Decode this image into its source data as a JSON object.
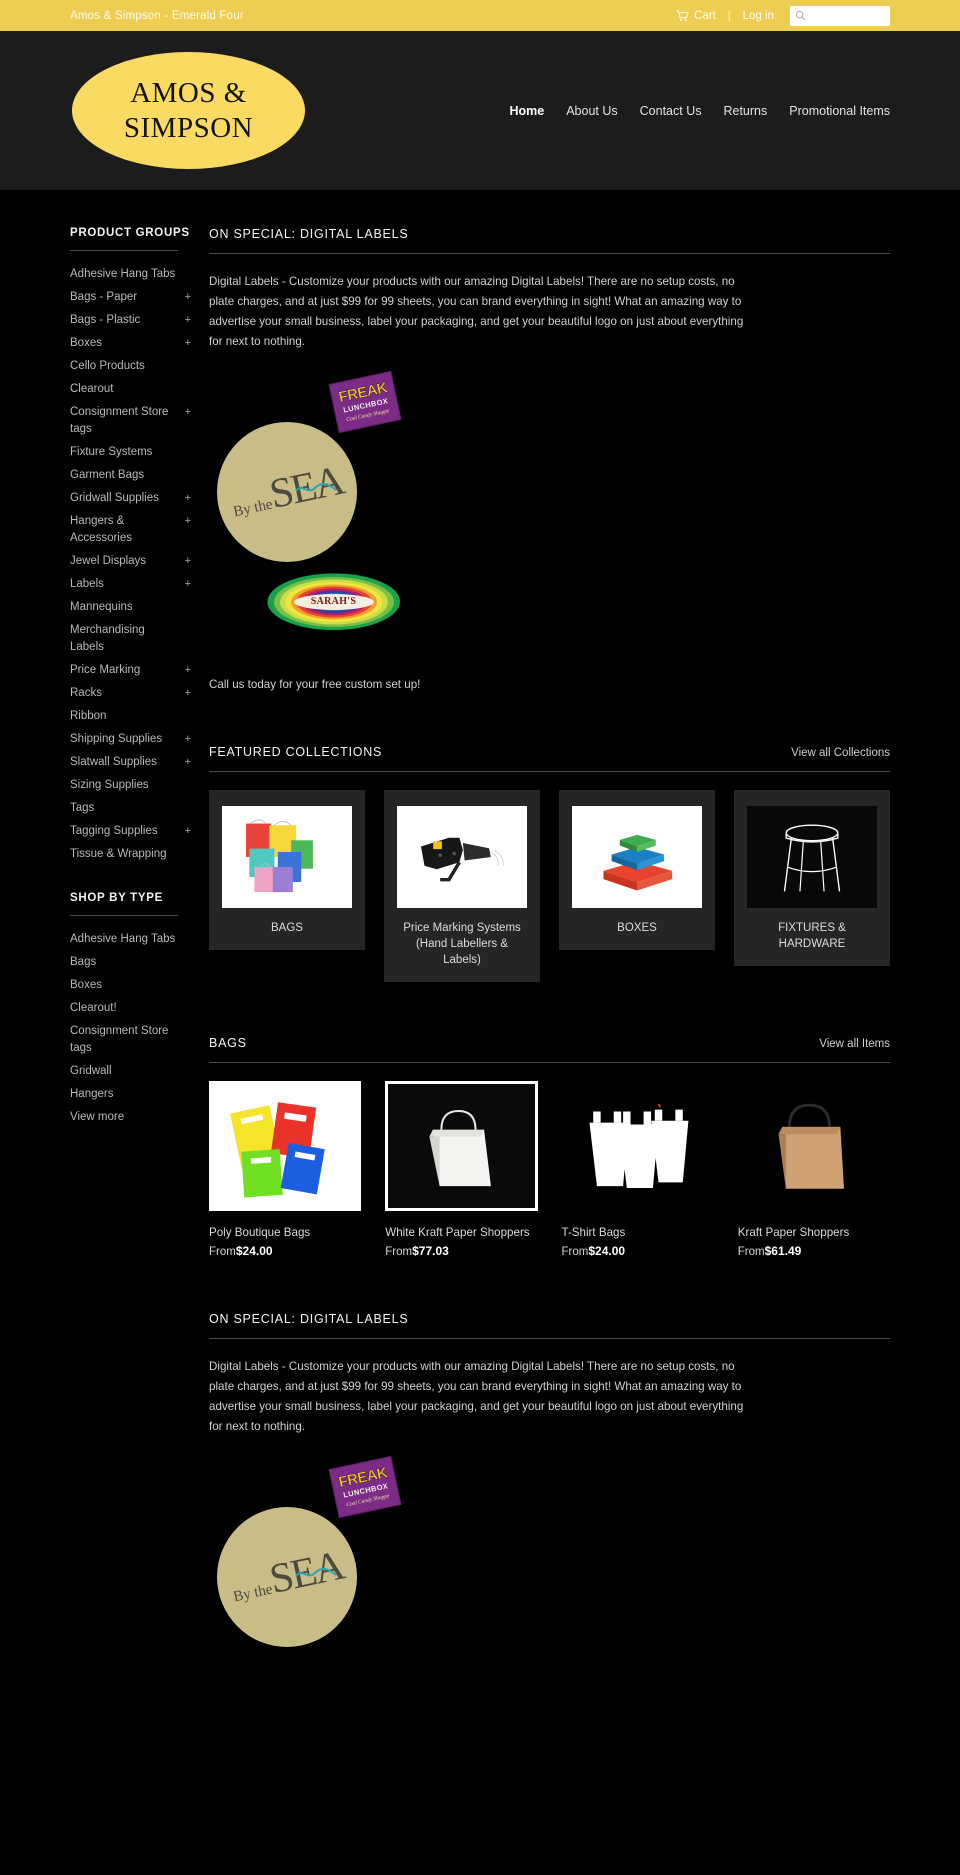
{
  "topbar": {
    "brand": "Amos & Simpson - Emerald Four",
    "cart_label": "Cart",
    "cart_icon": "shopping-cart-icon",
    "separator": "|",
    "login_label": "Log in",
    "search_placeholder": "",
    "search_value": "",
    "search_icon": "search-icon",
    "bg_color": "#edcd52"
  },
  "header": {
    "logo_line1": "AMOS &",
    "logo_line2": "SIMPSON",
    "logo_color": "#f9da63",
    "nav": [
      {
        "label": "Home",
        "active": true
      },
      {
        "label": "About Us",
        "active": false
      },
      {
        "label": "Contact Us",
        "active": false
      },
      {
        "label": "Returns",
        "active": false
      },
      {
        "label": "Promotional Items",
        "active": false
      }
    ]
  },
  "sidebar": {
    "product_groups_title": "PRODUCT GROUPS",
    "product_groups": [
      {
        "label": "Adhesive Hang Tabs",
        "expand": ""
      },
      {
        "label": "Bags - Paper",
        "expand": "+"
      },
      {
        "label": "Bags - Plastic",
        "expand": "+"
      },
      {
        "label": "Boxes",
        "expand": "+"
      },
      {
        "label": "Cello Products",
        "expand": ""
      },
      {
        "label": "Clearout",
        "expand": ""
      },
      {
        "label": "Consignment Store tags",
        "expand": "+"
      },
      {
        "label": "Fixture Systems",
        "expand": ""
      },
      {
        "label": "Garment Bags",
        "expand": ""
      },
      {
        "label": "Gridwall Supplies",
        "expand": "+"
      },
      {
        "label": "Hangers & Accessories",
        "expand": "+"
      },
      {
        "label": "Jewel Displays",
        "expand": "+"
      },
      {
        "label": "Labels",
        "expand": "+"
      },
      {
        "label": "Mannequins",
        "expand": ""
      },
      {
        "label": "Merchandising Labels",
        "expand": ""
      },
      {
        "label": "Price Marking",
        "expand": "+"
      },
      {
        "label": "Racks",
        "expand": "+"
      },
      {
        "label": "Ribbon",
        "expand": ""
      },
      {
        "label": "Shipping Supplies",
        "expand": "+"
      },
      {
        "label": "Slatwall Supplies",
        "expand": "+"
      },
      {
        "label": "Sizing Supplies",
        "expand": ""
      },
      {
        "label": "Tags",
        "expand": ""
      },
      {
        "label": "Tagging Supplies",
        "expand": "+"
      },
      {
        "label": "Tissue & Wrapping",
        "expand": ""
      }
    ],
    "shop_by_type_title": "SHOP BY TYPE",
    "shop_by_type": [
      {
        "label": "Adhesive Hang Tabs"
      },
      {
        "label": "Bags"
      },
      {
        "label": "Boxes"
      },
      {
        "label": "Clearout!"
      },
      {
        "label": "Consignment Store tags"
      },
      {
        "label": "Gridwall"
      },
      {
        "label": "Hangers"
      },
      {
        "label": "View more"
      }
    ]
  },
  "special": {
    "title": "ON SPECIAL: DIGITAL LABELS",
    "body": "Digital Labels - Customize your products with our amazing Digital Labels! There are no setup costs, no plate charges, and at just $99 for 99 sheets, you can brand everything in sight!  What an amazing way to advertise your small business, label your packaging, and get your beautiful logo on just about everything for next to nothing.",
    "closing": "Call us today for your free custom set up!",
    "art": {
      "freak_line1": "FREAK",
      "freak_line2": "LUNCHBOX",
      "freak_line3": "Cool Candy Shoppe",
      "sea_small": "By the",
      "sea_big": "SEA",
      "sarahs": "SARAH'S"
    }
  },
  "collections": {
    "title": "FEATURED COLLECTIONS",
    "view_all": "View all Collections",
    "items": [
      {
        "name": "BAGS",
        "thumb": "colorful-paper-bags-image"
      },
      {
        "name": "Price Marking Systems (Hand Labellers & Labels)",
        "thumb": "price-gun-image"
      },
      {
        "name": "BOXES",
        "thumb": "stacked-boxes-image"
      },
      {
        "name": "FIXTURES & HARDWARE",
        "thumb": "display-stand-image"
      }
    ]
  },
  "bags": {
    "title": "BAGS",
    "view_all": "View all Items",
    "items": [
      {
        "name": "Poly Boutique Bags",
        "from": "From",
        "price": "$24.00",
        "thumb": "poly-boutique-bags-image"
      },
      {
        "name": "White Kraft Paper Shoppers",
        "from": "From",
        "price": "$77.03",
        "thumb": "white-kraft-shopper-image"
      },
      {
        "name": "T-Shirt Bags",
        "from": "From",
        "price": "$24.00",
        "thumb": "tshirt-bags-image"
      },
      {
        "name": "Kraft Paper Shoppers",
        "from": "From",
        "price": "$61.49",
        "thumb": "kraft-paper-shopper-image"
      }
    ]
  },
  "special2": {
    "title": "ON SPECIAL: DIGITAL LABELS",
    "body": "Digital Labels - Customize your products with our amazing Digital Labels! There are no setup costs, no plate charges, and at just $99 for 99 sheets, you can brand everything in sight!  What an amazing way to advertise your small business, label your packaging, and get your beautiful logo on just about everything for next to nothing."
  }
}
